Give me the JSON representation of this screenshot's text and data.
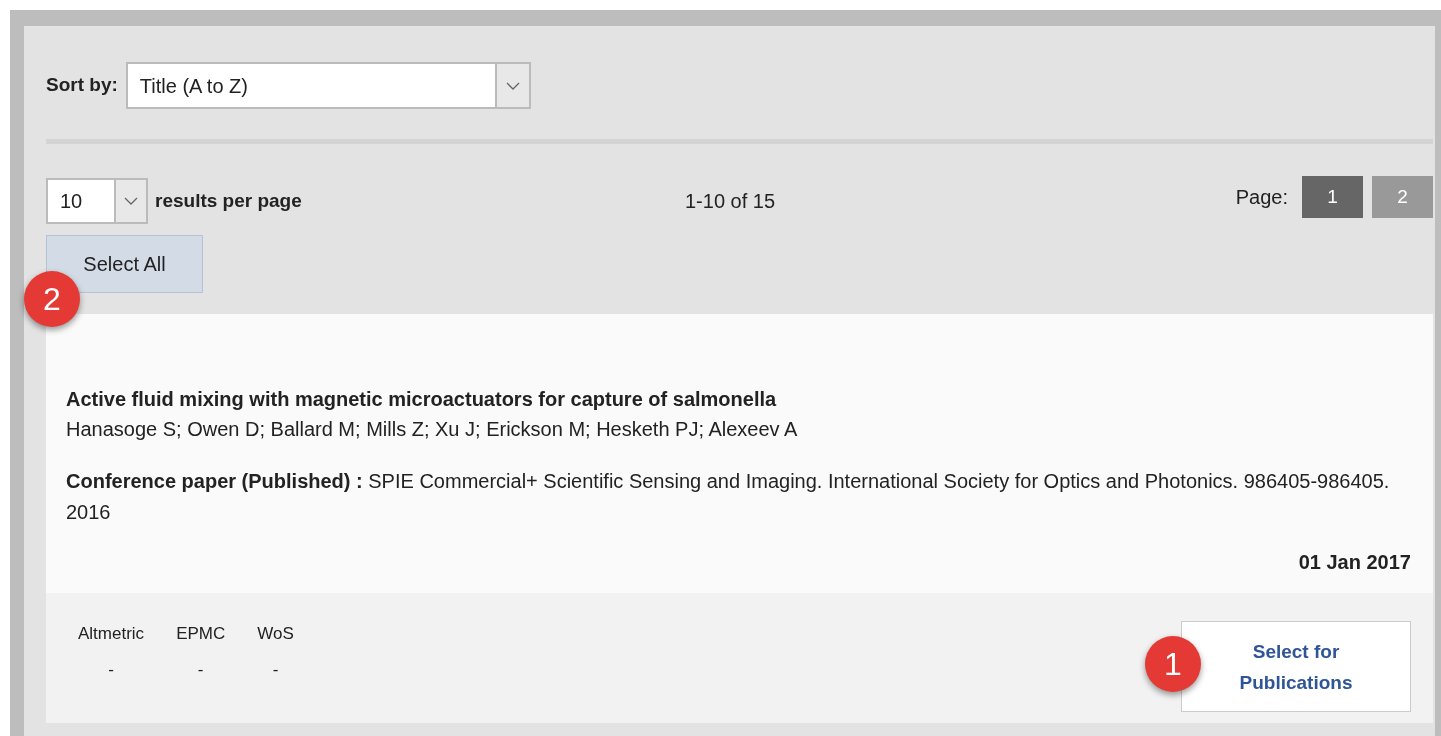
{
  "sort": {
    "label": "Sort by:",
    "value": "Title (A to Z)"
  },
  "per_page": {
    "value": "10",
    "label": "results per page"
  },
  "range": "1-10 of 15",
  "pagination": {
    "label": "Page:",
    "pages": [
      {
        "label": "1",
        "selected": true
      },
      {
        "label": "2",
        "selected": false
      }
    ]
  },
  "select_all": {
    "label": "Select All",
    "callout": "2"
  },
  "publication": {
    "title": "Active fluid mixing with magnetic microactuators for capture of salmonella",
    "authors": "Hanasoge S; Owen D; Ballard M; Mills Z; Xu J; Erickson M; Hesketh PJ; Alexeev A",
    "citation": "**Conference paper (Published) :** SPIE Commercial+ Scientific Sensing and Imaging. International Society for Optics and Photonics. 986405-986405. 2016",
    "date": "01 Jan 2017",
    "metrics": [
      {
        "name": "Altmetric",
        "value": "-"
      },
      {
        "name": "EPMC",
        "value": "-"
      },
      {
        "name": "WoS",
        "value": "-"
      }
    ],
    "select_button": {
      "label": "Select for Publications",
      "callout": "1"
    }
  }
}
